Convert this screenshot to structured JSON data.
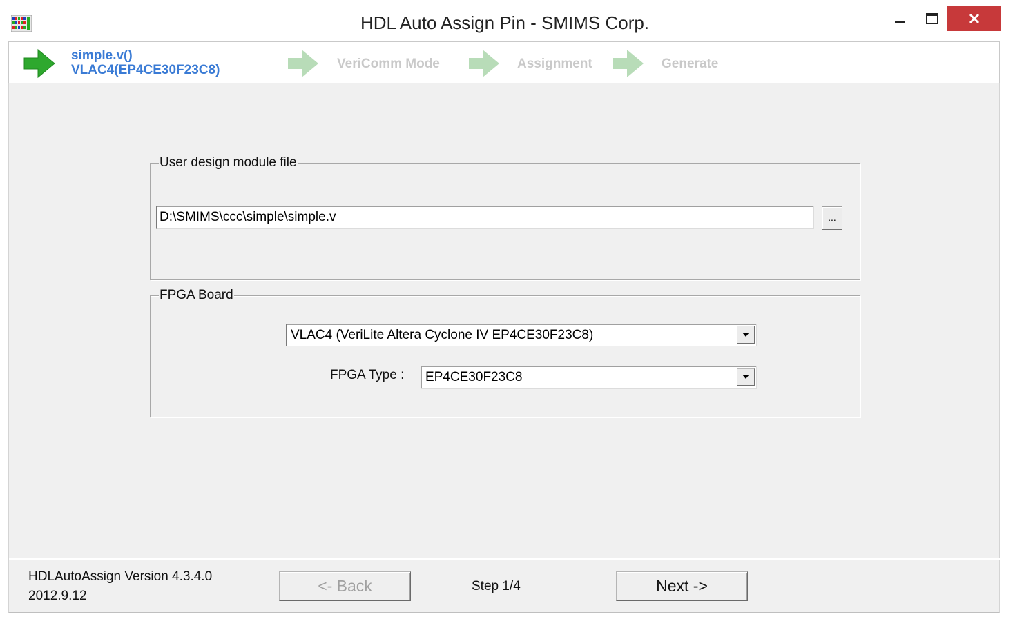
{
  "window": {
    "title": "HDL Auto Assign Pin - SMIMS Corp.",
    "close_color": "#c7393a"
  },
  "wizard_header": {
    "current_step_line1": "simple.v()",
    "current_step_line2": "VLAC4(EP4CE30F23C8)",
    "steps": [
      "VeriComm Mode",
      "Assignment",
      "Generate"
    ],
    "active_arrow_color": "#2ea82e",
    "inactive_arrow_color": "#b8dcb8"
  },
  "design_file_group": {
    "legend": "User design module file",
    "path_value": "D:\\SMIMS\\ccc\\simple\\simple.v",
    "browse_label": "..."
  },
  "fpga_board_group": {
    "legend": "FPGA  Board",
    "board_selected": "VLAC4 (VeriLite Altera Cyclone IV EP4CE30F23C8)",
    "fpga_type_label": "FPGA Type :",
    "fpga_type_selected": "EP4CE30F23C8"
  },
  "footer": {
    "version_line1": "HDLAutoAssign Version 4.3.4.0",
    "version_line2": "2012.9.12",
    "back_label": "<-  Back",
    "step_text": "Step 1/4",
    "next_label": "Next  ->"
  }
}
